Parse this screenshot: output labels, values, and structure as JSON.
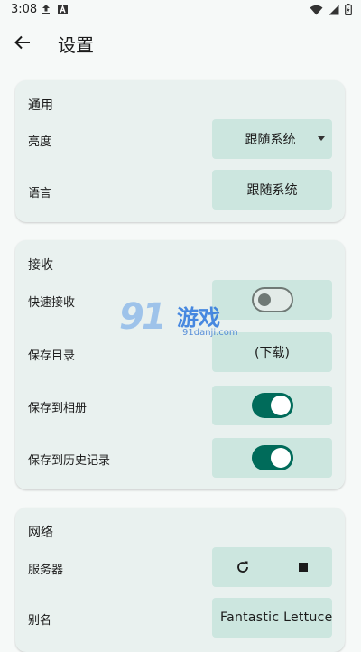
{
  "status_bar": {
    "time": "3:08",
    "icons_left": [
      "upload-arrow-icon",
      "a-notification-icon"
    ],
    "icons_right": [
      "wifi-icon",
      "signal-icon",
      "battery-icon"
    ]
  },
  "app_bar": {
    "title": "设置",
    "back_icon": "arrow-left-icon"
  },
  "general": {
    "title": "通用",
    "brightness": {
      "label": "亮度",
      "value": "跟随系统"
    },
    "language": {
      "label": "语言",
      "value": "跟随系统"
    }
  },
  "receive": {
    "title": "接收",
    "quick_receive": {
      "label": "快速接收",
      "enabled": false
    },
    "save_dir": {
      "label": "保存目录",
      "value": "(下载)"
    },
    "save_album": {
      "label": "保存到相册",
      "enabled": true
    },
    "save_history": {
      "label": "保存到历史记录",
      "enabled": true
    }
  },
  "network": {
    "title": "网络",
    "server": {
      "label": "服务器",
      "icons": [
        "refresh-icon",
        "stop-icon"
      ]
    },
    "alias": {
      "label": "别名",
      "value": "Fantastic Lettuce"
    }
  },
  "watermark": {
    "logo": "91",
    "brand": "游戏",
    "site": "91danji.com"
  },
  "colors": {
    "background": "#f6f9f8",
    "card": "#e9f1ef",
    "control": "#cce6df",
    "accent": "#006b5a"
  }
}
